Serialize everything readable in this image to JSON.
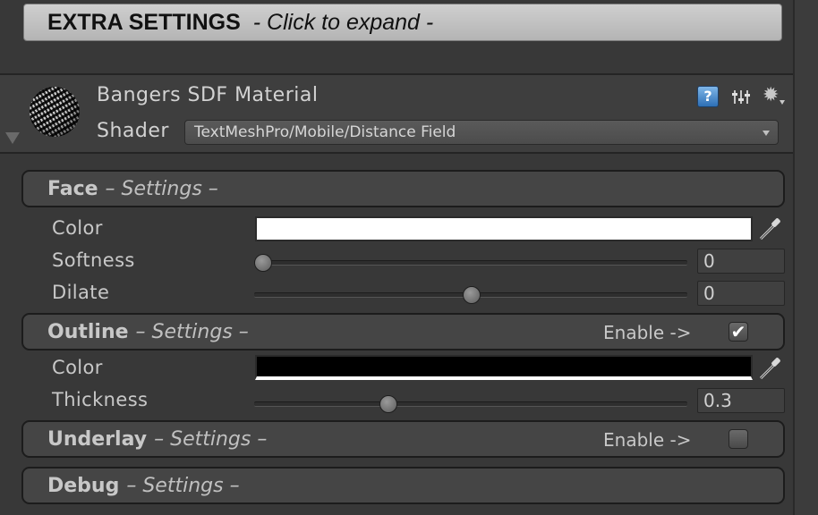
{
  "extra_settings": {
    "title": "EXTRA SETTINGS",
    "hint": "- Click to expand -"
  },
  "material": {
    "name": "Bangers SDF Material",
    "shader_label": "Shader",
    "shader_value": "TextMeshPro/Mobile/Distance Field",
    "icons": [
      "help-icon",
      "presets-icon",
      "gear-icon"
    ]
  },
  "face": {
    "title": "Face",
    "subtitle": "– Settings –",
    "color_label": "Color",
    "color_value": "#ffffff",
    "softness_label": "Softness",
    "softness_value": "0",
    "softness_fraction": 0.0,
    "dilate_label": "Dilate",
    "dilate_value": "0",
    "dilate_fraction": 0.5
  },
  "outline": {
    "title": "Outline",
    "subtitle": "– Settings –",
    "enable_label": "Enable ->",
    "enabled": true,
    "color_label": "Color",
    "color_value": "#000000",
    "thickness_label": "Thickness",
    "thickness_value": "0.3",
    "thickness_fraction": 0.3
  },
  "underlay": {
    "title": "Underlay",
    "subtitle": "– Settings –",
    "enable_label": "Enable ->",
    "enabled": false
  },
  "debug": {
    "title": "Debug",
    "subtitle": "– Settings –"
  }
}
